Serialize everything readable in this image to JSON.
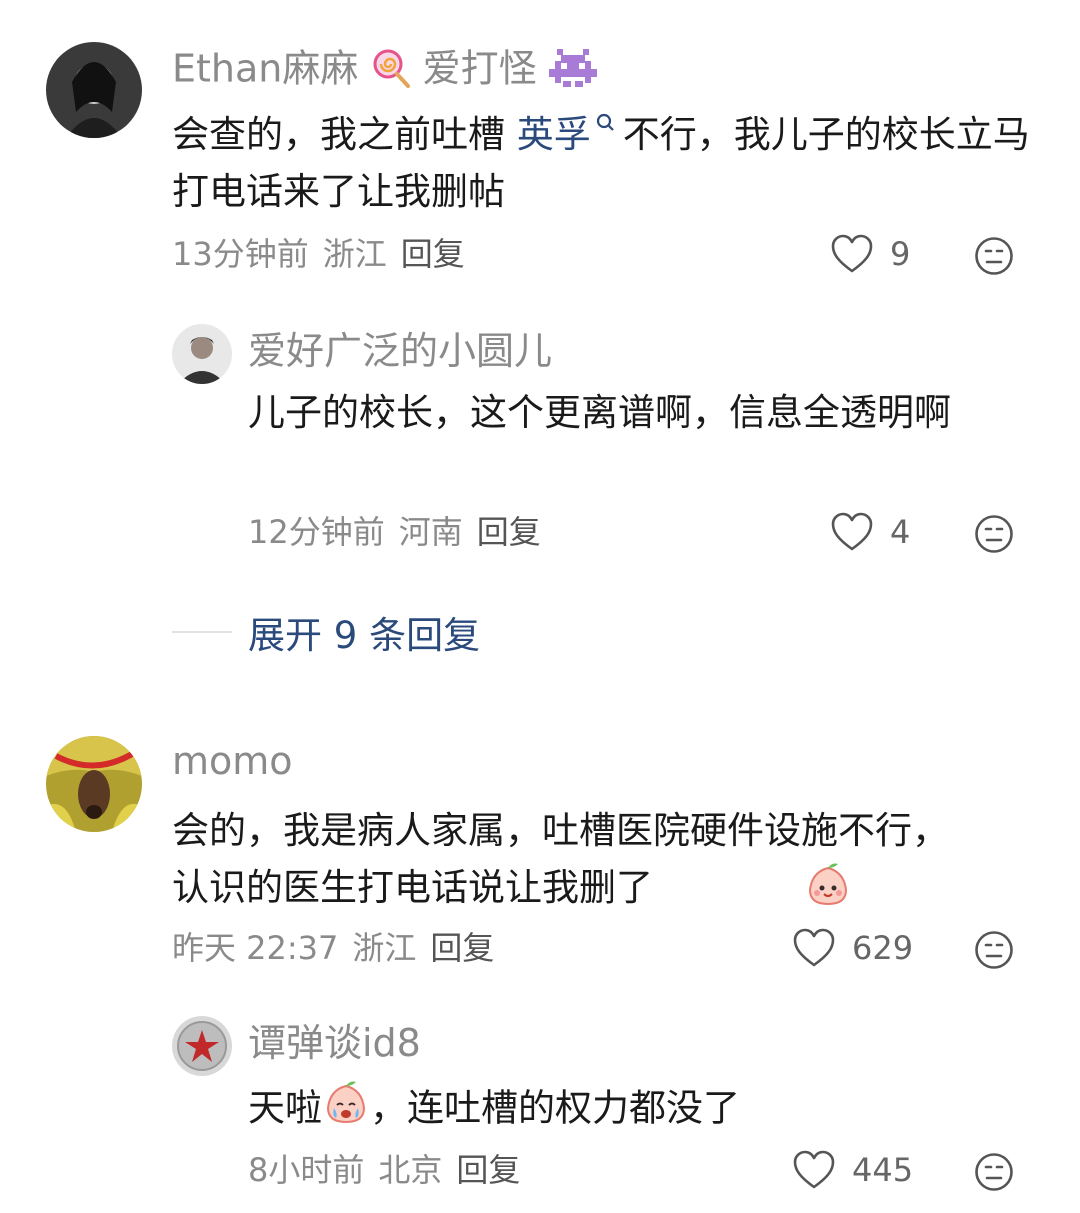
{
  "comments": [
    {
      "name": "Ethan麻麻",
      "name_suffix": "爱打怪",
      "text_before_link": "会查的，我之前吐槽",
      "link_text": "英孚",
      "text_after_link": "不行，我儿子的校长立马打电话来了让我删帖",
      "time": "13分钟前",
      "location": "浙江",
      "reply_label": "回复",
      "likes": "9",
      "replies": [
        {
          "name": "爱好广泛的小圆儿",
          "text": "儿子的校长，这个更离谱啊，信息全透明啊",
          "time": "12分钟前",
          "location": "河南",
          "reply_label": "回复",
          "likes": "4"
        }
      ],
      "expand_label": "展开 9 条回复"
    },
    {
      "name": "momo",
      "text": "会的，我是病人家属，吐槽医院硬件设施不行，认识的医生打电话说让我删了",
      "time": "昨天 22:37",
      "location": "浙江",
      "reply_label": "回复",
      "likes": "629",
      "replies": [
        {
          "name": "谭弹谈id8",
          "text_before_emoji": "天啦",
          "text_after_emoji": "，连吐槽的权力都没了",
          "time": "8小时前",
          "location": "北京",
          "reply_label": "回复",
          "likes": "445"
        }
      ]
    }
  ],
  "icons": {
    "like": "heart-outline-icon",
    "dislike": "meh-face-icon",
    "emoji_lollipop": "lollipop-emoji",
    "emoji_invader": "space-invader-emoji",
    "emoji_peach_smile": "peach-smile-emoji",
    "emoji_peach_cry": "peach-cry-emoji",
    "search": "search-icon"
  },
  "colors": {
    "name": "#8a8a8a",
    "link": "#2a4a7c",
    "text": "#1a1a1a"
  }
}
